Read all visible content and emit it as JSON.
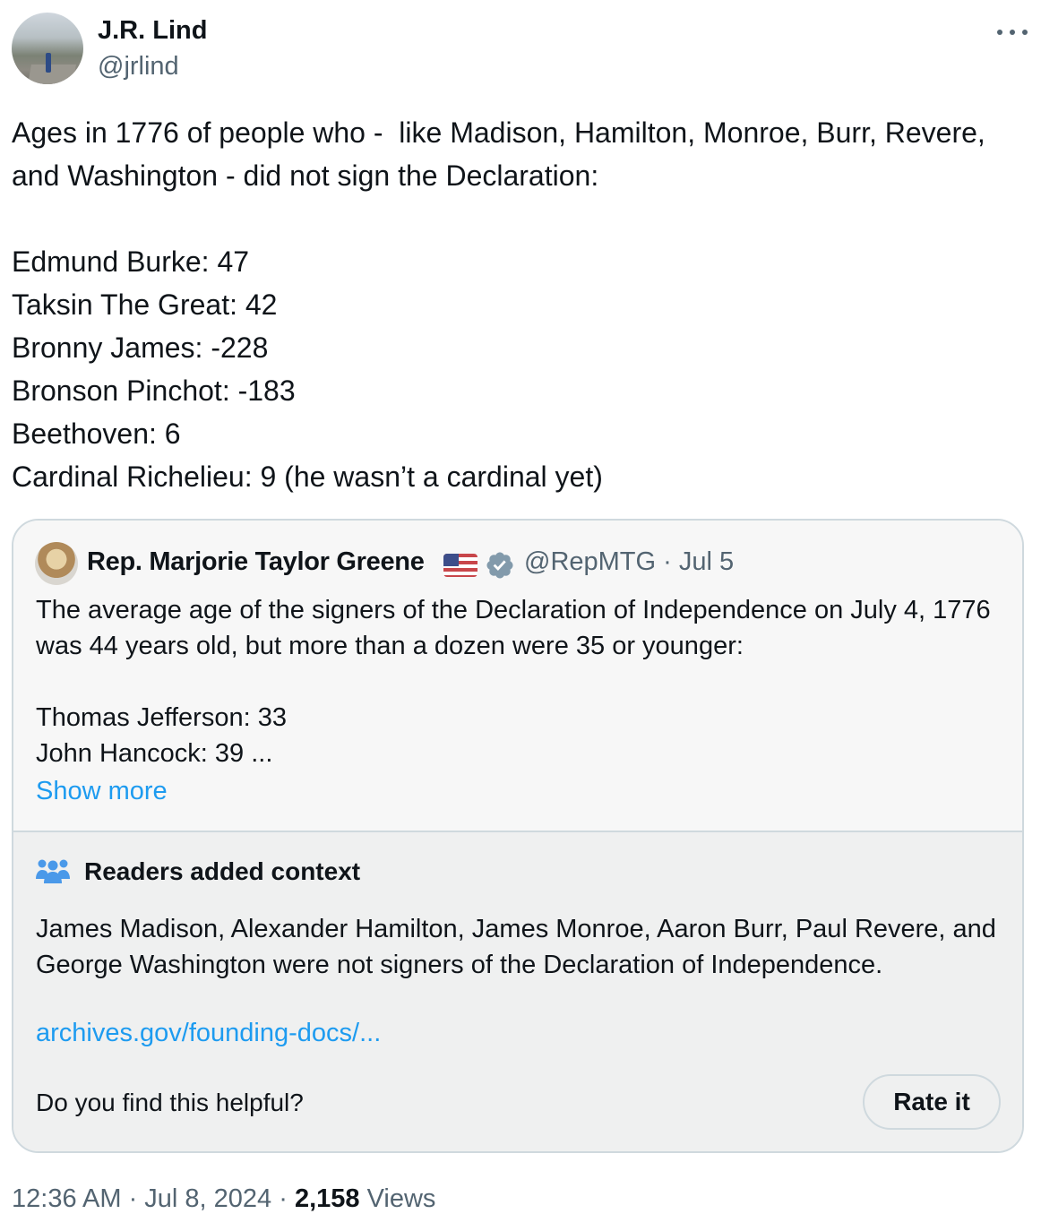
{
  "author": {
    "display_name": "J.R. Lind",
    "handle": "@jrlind",
    "avatar_icon": "profile-photo"
  },
  "more_icon": "ellipsis-icon",
  "tweet": {
    "text": "Ages in 1776 of people who -  like Madison, Hamilton, Monroe, Burr, Revere, and Washington - did not sign the Declaration:\n\nEdmund Burke: 47\nTaksin The Great: 42\nBronny James: -228\nBronson Pinchot: -183\nBeethoven: 6\nCardinal Richelieu: 9 (he wasn’t a cardinal yet)"
  },
  "quoted_tweet": {
    "display_name": "Rep. Marjorie Taylor Greene",
    "flag_icon": "us-flag-icon",
    "verified_icon": "verified-badge-icon",
    "handle_date": "@RepMTG · Jul 5",
    "text": "The average age of the signers of the Declaration of Independence on July 4, 1776 was 44 years old, but more than a dozen were 35 or younger:\n\nThomas Jefferson: 33\nJohn Hancock: 39 ...",
    "show_more": "Show more"
  },
  "community_note": {
    "icon": "people-icon",
    "title": "Readers added context",
    "body": "James Madison, Alexander Hamilton, James Monroe, Aaron Burr, Paul Revere, and George Washington were not signers of the Declaration of Independence.",
    "link": "archives.gov/founding-docs/...",
    "helpful_prompt": "Do you find this helpful?",
    "rate_button": "Rate it"
  },
  "meta": {
    "time_date": "12:36 AM · Jul 8, 2024 · ",
    "views_count": "2,158",
    "views_label": " Views"
  },
  "colors": {
    "link_blue": "#1d9bf0",
    "secondary_text": "#536471",
    "border": "#cfd9de",
    "note_bg": "#eff0f0"
  }
}
